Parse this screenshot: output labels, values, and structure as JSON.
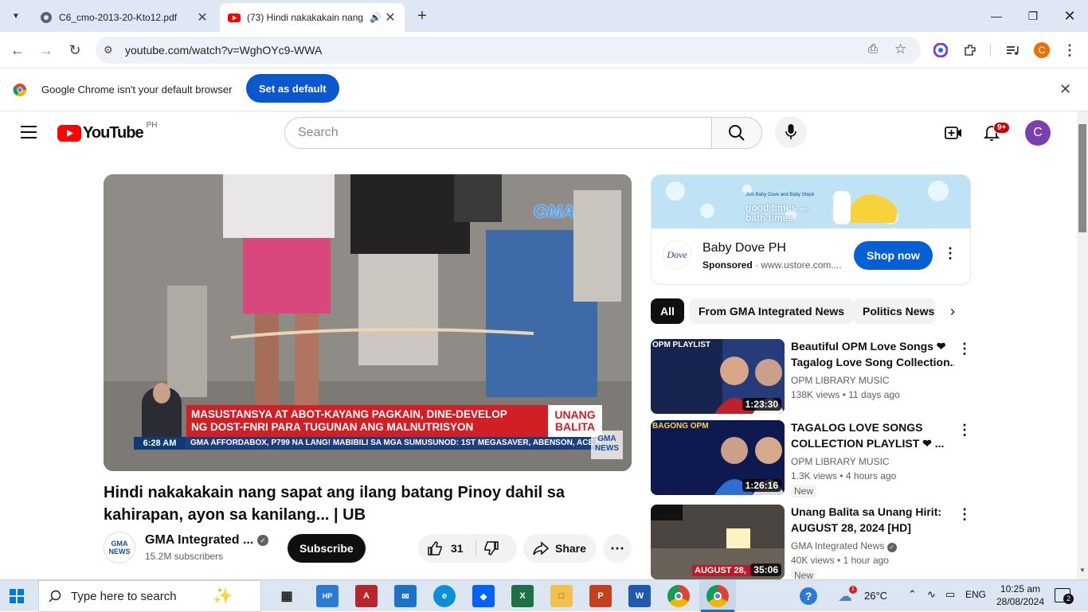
{
  "browser": {
    "tabs": [
      {
        "title": "C6_cmo-2013-20-Kto12.pdf"
      },
      {
        "title": "(73) Hindi nakakakain nang"
      }
    ],
    "url": "youtube.com/watch?v=WghOYc9-WWA",
    "profile_initial": "C"
  },
  "infobar": {
    "message": "Google Chrome isn't your default browser",
    "button": "Set as default"
  },
  "youtube": {
    "logo_text": "YouTube",
    "region": "PH",
    "search_placeholder": "Search",
    "notification_count": "9+",
    "avatar_initial": "C"
  },
  "video": {
    "overlay": {
      "gma_logo": "GMA",
      "headline_line1": "MASUSTANSYA AT ABOT-KAYANG PAGKAIN, DINE-DEVELOP",
      "headline_line2": "NG DOST-FNRI PARA TUGUNAN ANG MALNUTRISYON",
      "program": "UNANG BALITA",
      "time": "6:28 AM",
      "ticker": "GMA AFFORDABOX, P799 NA LANG!  MABIBILI SA MGA SUMUSUNOD: 1ST MEGASAVER, ABENSON, ACE HARDWARE",
      "news_badge": "GMA NEWS"
    },
    "title": "Hindi nakakakain nang sapat ang ilang batang Pinoy dahil sa kahirapan, ayon sa kanilang... | UB",
    "channel": {
      "name": "GMA Integrated ...",
      "subscribers": "15.2M subscribers",
      "avatar_text": "GMA NEWS"
    },
    "subscribe_label": "Subscribe",
    "likes": "31",
    "share_label": "Share"
  },
  "ad": {
    "banner_text_small": "Join Baby Dove and Baby Shark",
    "banner_text_big1": "good times",
    "banner_text_and": "and",
    "banner_text_big2": "bath times",
    "brand_logo": "Dove",
    "advertiser": "Baby Dove PH",
    "sponsored": "Sponsored",
    "domain": "www.ustore.com....",
    "cta": "Shop now"
  },
  "chips": [
    "All",
    "From GMA Integrated News",
    "Politics News"
  ],
  "recommendations": [
    {
      "title_line1": "Beautiful OPM Love Songs ❤",
      "title_line2": "Tagalog Love Song Collection...",
      "channel": "OPM LIBRARY MUSIC",
      "views": "138K views",
      "age": "11 days ago",
      "duration": "1:23:30",
      "thumb_label": "OPM PLAYLIST",
      "is_new": false
    },
    {
      "title_line1": "TAGALOG LOVE SONGS",
      "title_line2": "COLLECTION PLAYLIST ❤ ...",
      "channel": "OPM LIBRARY MUSIC",
      "views": "1.3K views",
      "age": "4 hours ago",
      "duration": "1:26:16",
      "thumb_label": "BAGONG OPM",
      "is_new": true,
      "new_label": "New"
    },
    {
      "title_line1": "Unang Balita sa Unang Hirit:",
      "title_line2": "AUGUST 28, 2024 [HD]",
      "channel": "GMA Integrated News",
      "views": "40K views",
      "age": "1 hour ago",
      "duration": "35:06",
      "thumb_label": "AUGUST 28,",
      "is_new": true,
      "new_label": "New"
    }
  ],
  "taskbar": {
    "search_placeholder": "Type here to search",
    "weather": "26°C",
    "language": "ENG",
    "time": "10:25 am",
    "date": "28/08/2024",
    "notifications": "2",
    "weather_badge": "1"
  },
  "colors": {
    "youtube_red": "#ff0000",
    "chrome_blue": "#0b57d0",
    "yt_blue": "#065fd4",
    "news_red": "#d21f26"
  }
}
